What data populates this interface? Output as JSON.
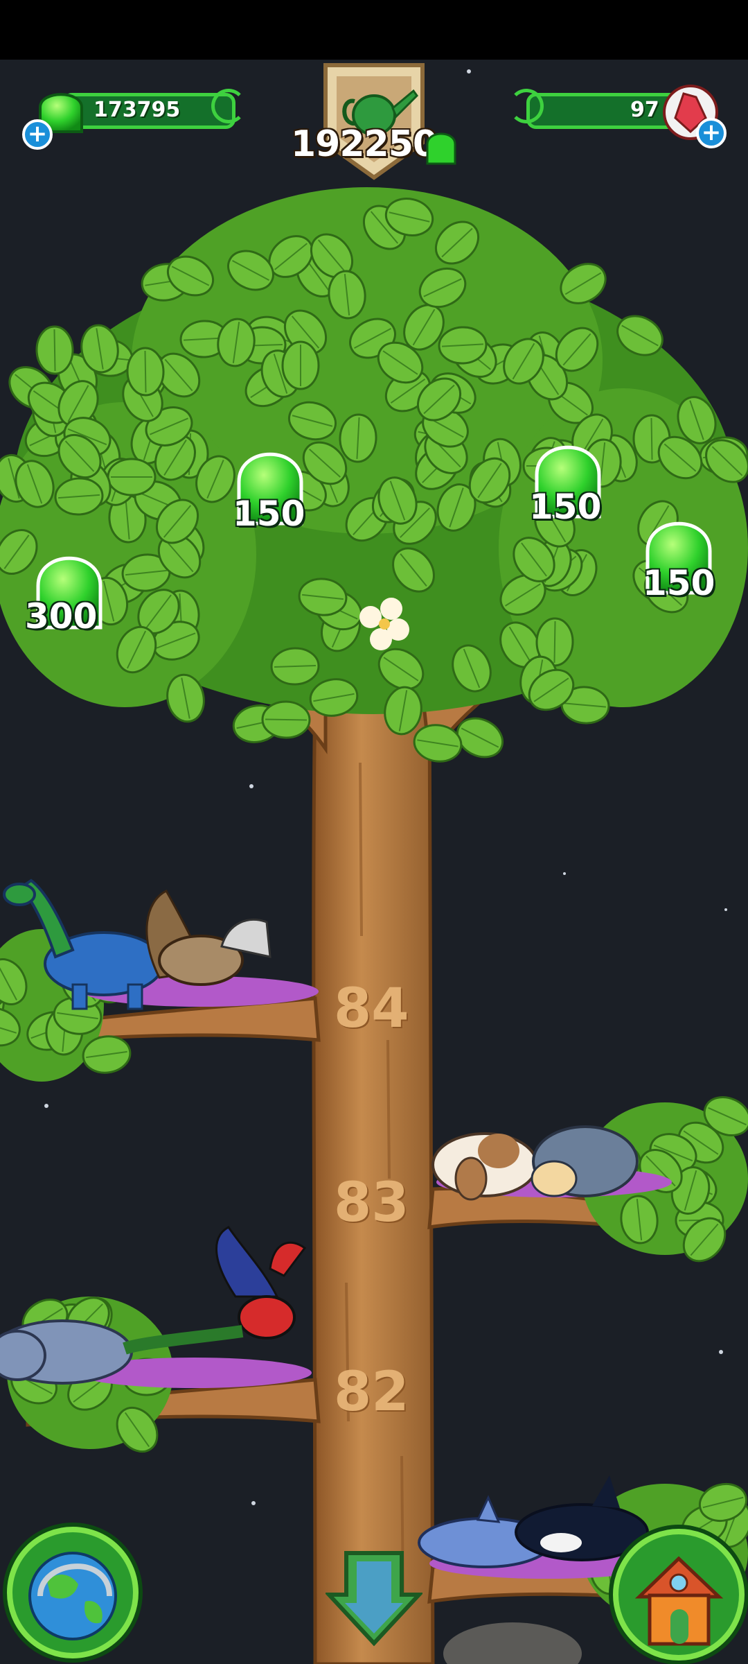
{
  "hud": {
    "left_counter": "173795",
    "center_counter": "192250",
    "right_counter": "97",
    "left_icon": "green-gem-icon",
    "right_icon": "red-crystal-icon",
    "center_icon": "watering-can-icon"
  },
  "gems": [
    {
      "label": "300"
    },
    {
      "label": "150"
    },
    {
      "label": "150"
    },
    {
      "label": "150"
    }
  ],
  "branches": [
    {
      "number": "84",
      "animals": [
        "brontosaurus",
        "turkey"
      ]
    },
    {
      "number": "83",
      "animals": [
        "rabbit",
        "hedgehog"
      ]
    },
    {
      "number": "82",
      "animals": [
        "panther",
        "phoenix"
      ]
    }
  ],
  "bottom_animals": [
    "dolphin",
    "orca"
  ],
  "buttons": {
    "left": "globe-icon",
    "center": "down-arrow-icon",
    "right": "house-icon"
  },
  "colors": {
    "background": "#1b1f26",
    "leaf": "#6fbf3a",
    "trunk": "#b87a43",
    "accent_green": "#3ed13f"
  }
}
